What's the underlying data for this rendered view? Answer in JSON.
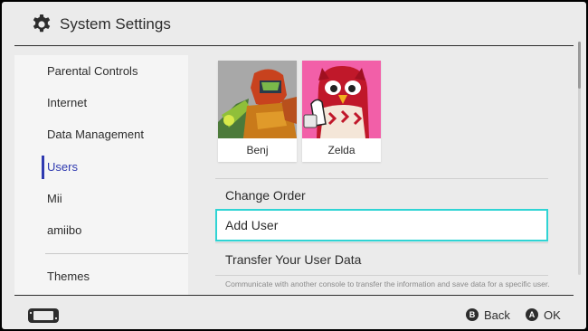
{
  "header": {
    "title": "System Settings",
    "icon": "gear-icon"
  },
  "sidebar": {
    "items": [
      {
        "label": "Parental Controls"
      },
      {
        "label": "Internet"
      },
      {
        "label": "Data Management"
      },
      {
        "label": "Users",
        "active": true
      },
      {
        "label": "Mii"
      },
      {
        "label": "amiibo"
      },
      {
        "label": "Themes"
      }
    ]
  },
  "users": [
    {
      "name": "Benj",
      "avatar_bg": "#a8a8a8"
    },
    {
      "name": "Zelda",
      "avatar_bg": "#f25fa8"
    }
  ],
  "menu": {
    "change_order": "Change Order",
    "add_user": "Add User",
    "transfer": "Transfer Your User Data",
    "transfer_desc": "Communicate with another console to transfer the information and save data for a specific user."
  },
  "footer": {
    "back_button": "B",
    "back_label": "Back",
    "ok_button": "A",
    "ok_label": "OK"
  },
  "colors": {
    "accent": "#2f3ab0",
    "focus": "#2fd4d4",
    "background": "#ebebeb"
  }
}
